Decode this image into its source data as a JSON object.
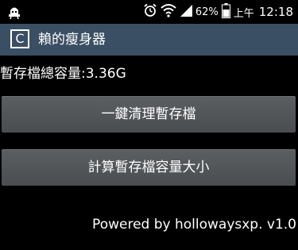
{
  "status_bar": {
    "battery_percent": "62%",
    "time_prefix": "上午",
    "time": "12:18",
    "icons": [
      "notification-icon",
      "alarm-icon",
      "wifi-icon",
      "signal-icon",
      "battery-icon"
    ]
  },
  "action_bar": {
    "app_icon_letter": "C",
    "title": "賴的瘦身器"
  },
  "main": {
    "total_cache_label": "暫存檔總容量:3.36G",
    "clean_button_label": "一鍵清理暫存檔",
    "calc_button_label": "計算暫存檔容量大小",
    "footer": "Powered by hollowaysxp. v1.0"
  },
  "colors": {
    "action_bar": "#3a4f63",
    "button": "#55585b",
    "background": "#000000"
  }
}
